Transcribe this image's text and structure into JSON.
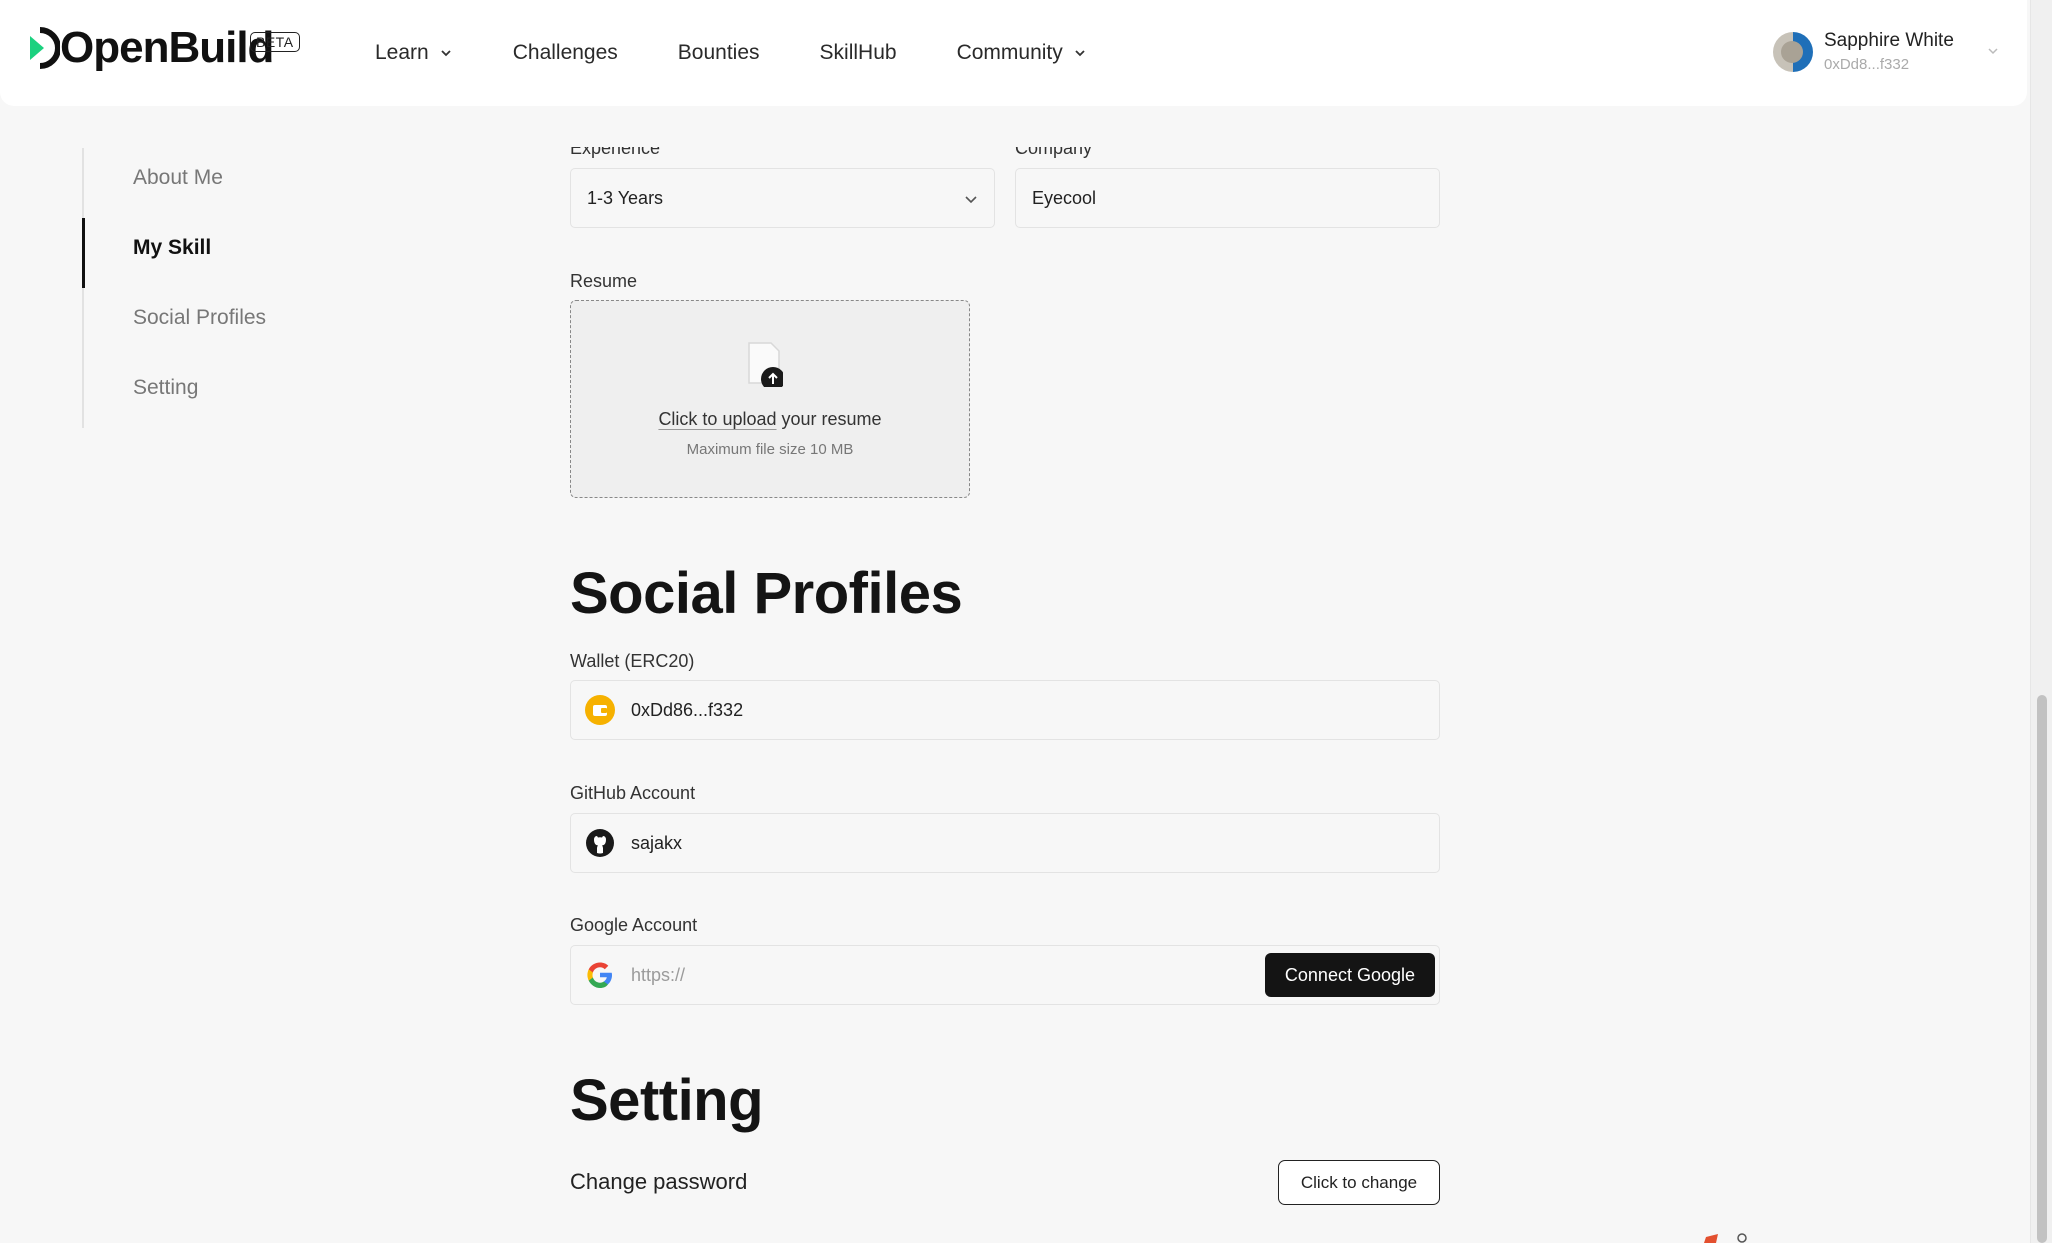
{
  "header": {
    "brand": "OpenBuild",
    "beta": "BETA",
    "nav": [
      {
        "label": "Learn",
        "has_dropdown": true
      },
      {
        "label": "Challenges",
        "has_dropdown": false
      },
      {
        "label": "Bounties",
        "has_dropdown": false
      },
      {
        "label": "SkillHub",
        "has_dropdown": false
      },
      {
        "label": "Community",
        "has_dropdown": true
      }
    ],
    "user": {
      "name": "Sapphire White",
      "address": "0xDd8...f332"
    }
  },
  "sidebar": {
    "items": [
      {
        "label": "About Me",
        "active": false
      },
      {
        "label": "My Skill",
        "active": true
      },
      {
        "label": "Social Profiles",
        "active": false
      },
      {
        "label": "Setting",
        "active": false
      }
    ]
  },
  "skill": {
    "experience_label": "Experience",
    "experience_value": "1-3 Years",
    "company_label": "Company",
    "company_value": "Eyecool",
    "resume_label": "Resume",
    "upload_link": "Click to upload",
    "upload_rest": " your resume",
    "upload_hint": "Maximum file size 10 MB"
  },
  "social": {
    "title": "Social Profiles",
    "wallet_label": "Wallet (ERC20)",
    "wallet_value": "0xDd86...f332",
    "github_label": "GitHub Account",
    "github_value": "sajakx",
    "google_label": "Google Account",
    "google_placeholder": "https://",
    "google_button": "Connect Google"
  },
  "setting": {
    "title": "Setting",
    "password_label": "Change password",
    "password_button": "Click to change"
  },
  "colors": {
    "accent": "#1bd17f",
    "dark": "#141414",
    "wallet": "#f6b100"
  }
}
